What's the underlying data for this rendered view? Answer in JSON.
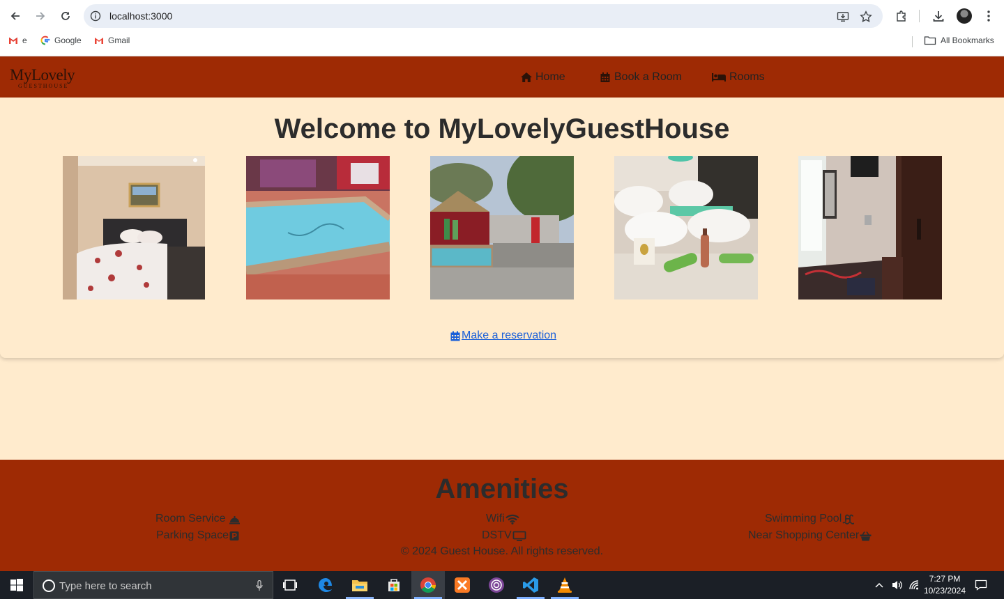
{
  "browser": {
    "url": "localhost:3000",
    "bookmarks": [
      {
        "label": "e",
        "icon": "gmail-icon"
      },
      {
        "label": "Google",
        "icon": "google-icon"
      },
      {
        "label": "Gmail",
        "icon": "gmail-icon"
      }
    ],
    "all_bookmarks_label": "All Bookmarks"
  },
  "site": {
    "logo_main": "MyLovely",
    "logo_sub": "GUESTHOUSE",
    "nav": [
      {
        "label": "Home",
        "icon": "home-icon"
      },
      {
        "label": "Book a Room",
        "icon": "calendar-icon"
      },
      {
        "label": "Rooms",
        "icon": "bed-icon"
      }
    ],
    "heading": "Welcome to MyLovelyGuestHouse",
    "photos": [
      "bedroom",
      "swimming-pool",
      "garden-party",
      "bed-with-towels",
      "room-interior"
    ],
    "reservation_link": "Make a reservation"
  },
  "footer": {
    "title": "Amenities",
    "amenities": [
      {
        "label": "Room Service",
        "icon": "bell-icon"
      },
      {
        "label": "Wifi",
        "icon": "wifi-icon"
      },
      {
        "label": "Swimming Pool",
        "icon": "pool-icon"
      },
      {
        "label": "Parking Space",
        "icon": "parking-icon"
      },
      {
        "label": "DSTV",
        "icon": "tv-icon"
      },
      {
        "label": "Near Shopping Center",
        "icon": "basket-icon"
      }
    ],
    "copyright": "© 2024 Guest House. All rights reserved."
  },
  "taskbar": {
    "search_placeholder": "Type here to search",
    "time": "7:27 PM",
    "date": "10/23/2024"
  },
  "colors": {
    "brand": "#9e2a04",
    "background": "#ffebcd",
    "link": "#1a5fd8"
  }
}
